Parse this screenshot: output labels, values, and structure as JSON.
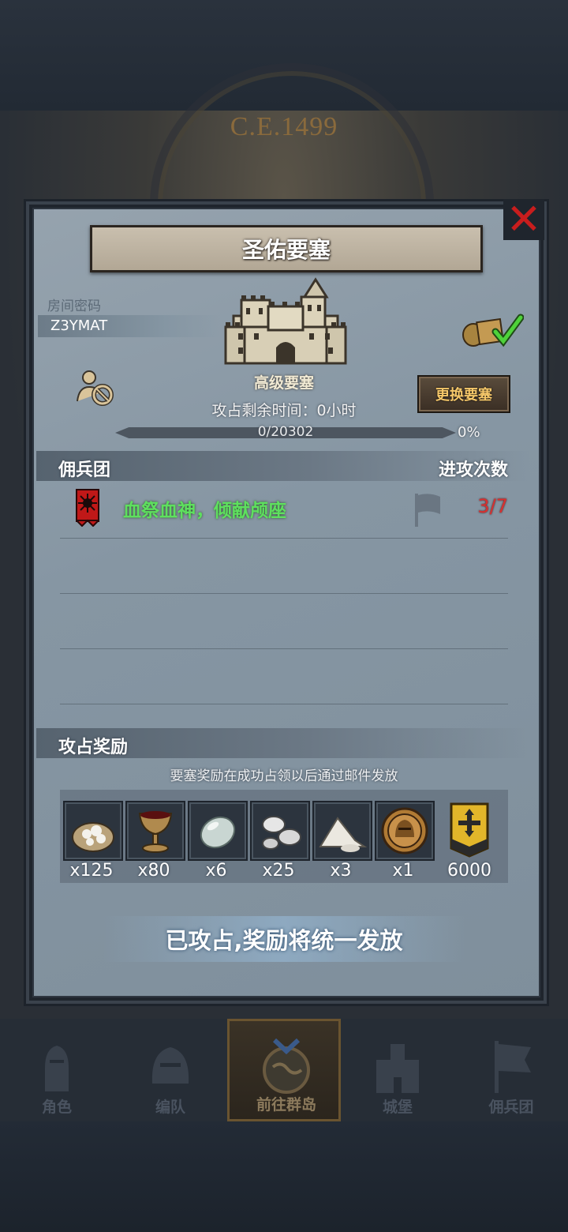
{
  "background": {
    "year": "C.E.1499"
  },
  "dialog": {
    "title": "圣佑要塞",
    "room_label": "房间密码",
    "room_code": "Z3YMAT",
    "fortress_name": "高级要塞",
    "time_label": "攻占剩余时间：0小时",
    "change_button": "更换要塞",
    "progress": {
      "text": "0/20302",
      "percent_text": "0%",
      "fraction": 0.0
    },
    "guild_section": {
      "title": "佣兵团",
      "attacks_header": "进攻次数",
      "rows": [
        {
          "name": "血祭血神，倾献颅座",
          "attacks": "3/7"
        }
      ]
    },
    "reward_section": {
      "title": "攻占奖励",
      "note": "要塞奖励在成功占领以后通过邮件发放",
      "items": [
        {
          "icon": "salt-sack-icon",
          "qty": "x125"
        },
        {
          "icon": "goblet-icon",
          "qty": "x80"
        },
        {
          "icon": "moonstone-icon",
          "qty": "x6"
        },
        {
          "icon": "silver-ore-icon",
          "qty": "x25"
        },
        {
          "icon": "white-powder-icon",
          "qty": "x3"
        },
        {
          "icon": "knight-medal-icon",
          "qty": "x1"
        },
        {
          "icon": "guild-banner-icon",
          "qty": "6000"
        }
      ]
    },
    "status_message": "已攻占,奖励将统一发放"
  },
  "tabbar": {
    "tabs": [
      {
        "label": "角色",
        "icon": "knight-icon"
      },
      {
        "label": "编队",
        "icon": "helmet-icon"
      },
      {
        "label": "前往群岛",
        "icon": "globe-icon",
        "active": true
      },
      {
        "label": "城堡",
        "icon": "castle-icon"
      },
      {
        "label": "佣兵团",
        "icon": "banner-icon"
      }
    ]
  },
  "colors": {
    "guild_name": "#5ee05e",
    "attack_count": "#d83030",
    "close_x": "#c81d1d",
    "change_button_text": "#f6c86a"
  }
}
